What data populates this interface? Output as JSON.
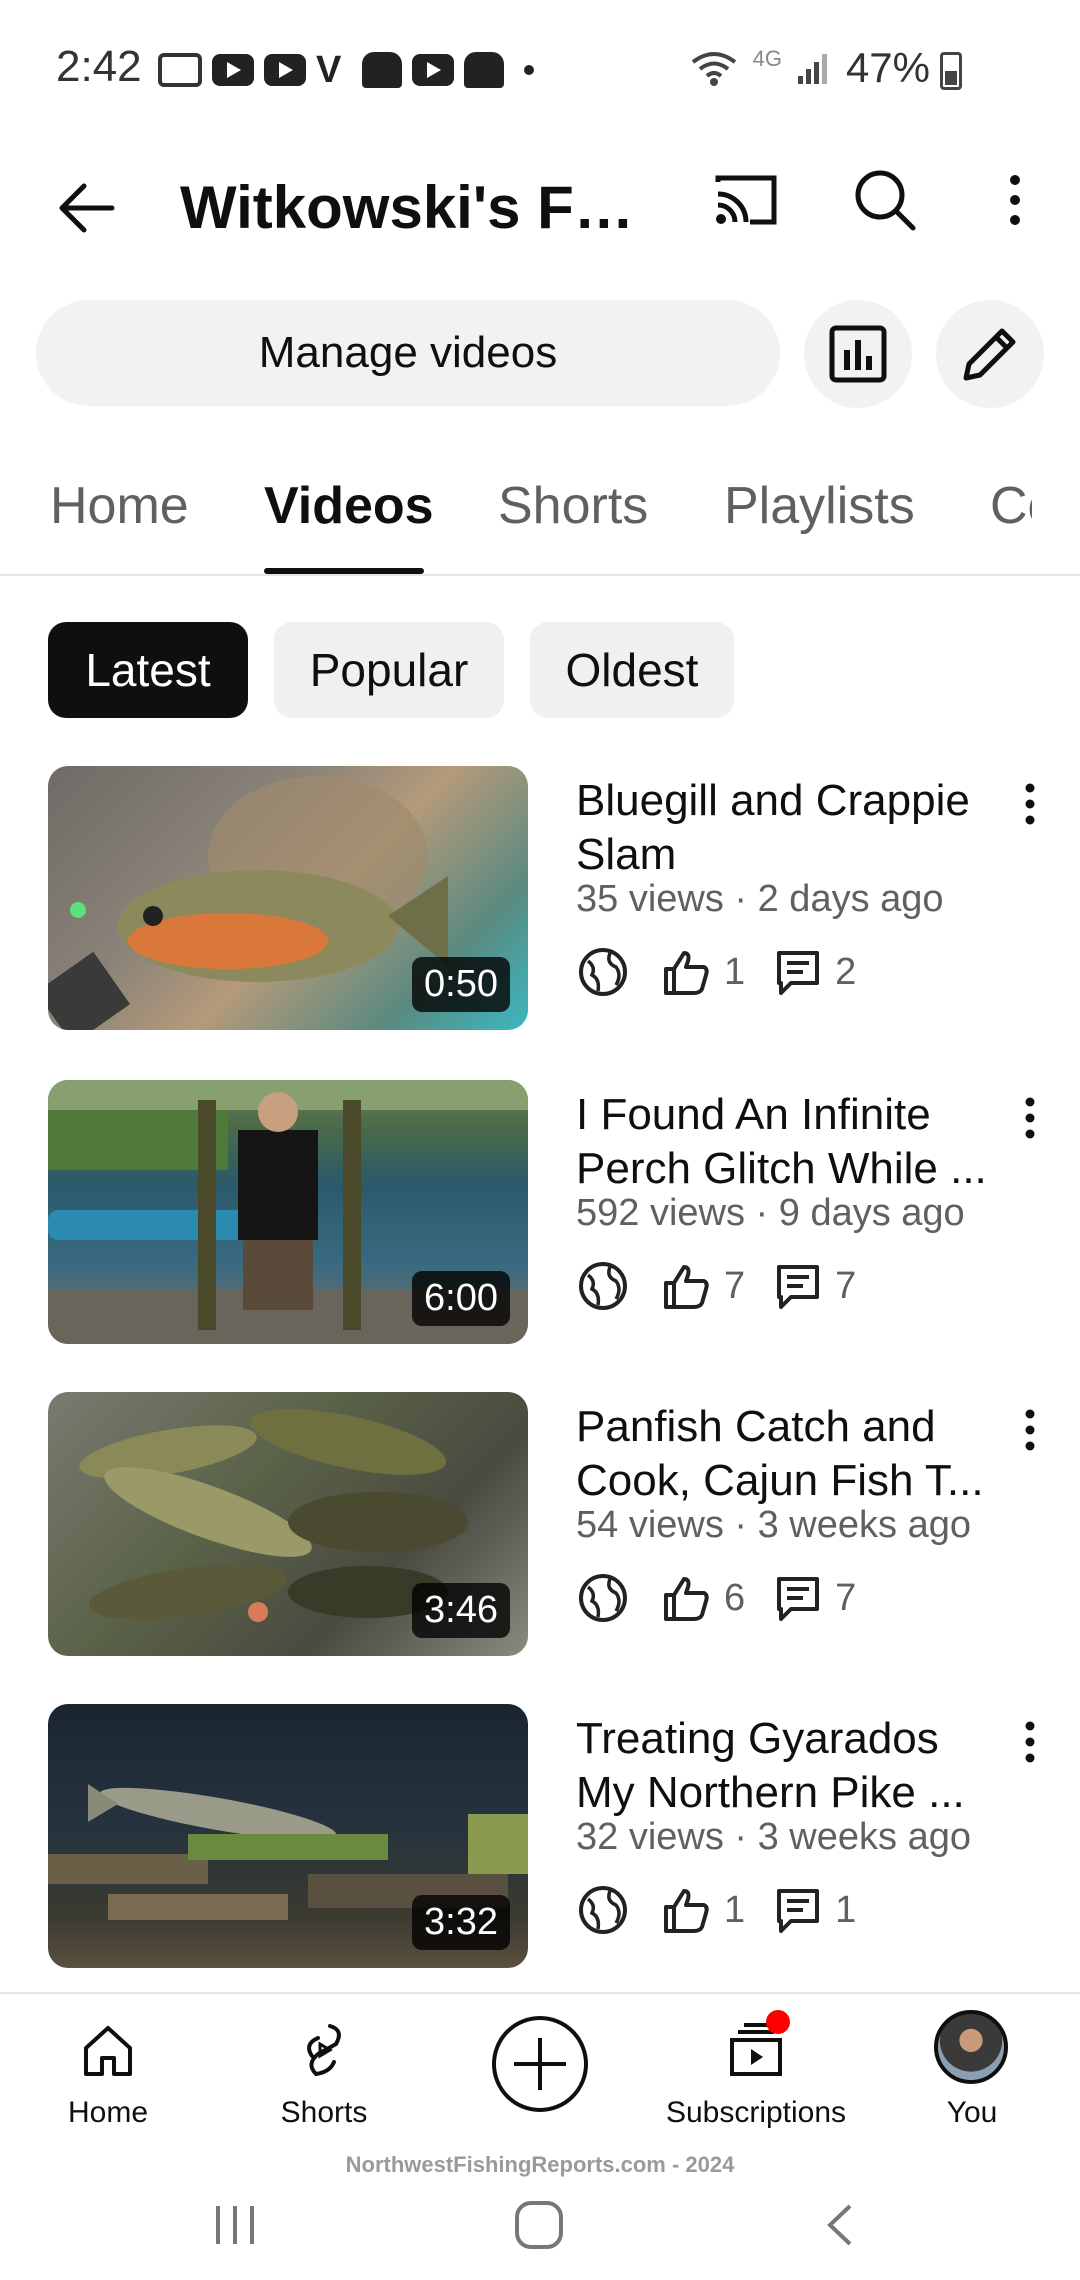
{
  "status_bar": {
    "time": "2:42",
    "network_label": "4G",
    "battery": "47%",
    "notification_icons": [
      "message-icon",
      "youtube-icon",
      "youtube-icon",
      "v-icon",
      "tooth-icon",
      "youtube-icon",
      "tooth-icon",
      "dot-icon"
    ]
  },
  "app_bar": {
    "title": "Witkowski's Fis..."
  },
  "actions": {
    "manage_videos": "Manage videos"
  },
  "tabs": [
    {
      "label": "Home"
    },
    {
      "label": "Videos",
      "active": true
    },
    {
      "label": "Shorts"
    },
    {
      "label": "Playlists"
    },
    {
      "label": "Co"
    }
  ],
  "chips": [
    {
      "label": "Latest",
      "active": true
    },
    {
      "label": "Popular"
    },
    {
      "label": "Oldest"
    }
  ],
  "videos": [
    {
      "title": "Bluegill and Crappie Slam",
      "meta": "35 views · 2 days ago",
      "duration": "0:50",
      "likes": "1",
      "comments": "2"
    },
    {
      "title": "I Found An Infinite Perch Glitch While ...",
      "meta": "592 views · 9 days ago",
      "duration": "6:00",
      "likes": "7",
      "comments": "7"
    },
    {
      "title": "Panfish Catch and Cook, Cajun Fish T...",
      "meta": "54 views · 3 weeks ago",
      "duration": "3:46",
      "likes": "6",
      "comments": "7"
    },
    {
      "title": "Treating Gyarados My Northern Pike ...",
      "meta": "32 views · 3 weeks ago",
      "duration": "3:32",
      "likes": "1",
      "comments": "1"
    }
  ],
  "bottom_nav": {
    "home": "Home",
    "shorts": "Shorts",
    "subscriptions": "Subscriptions",
    "you": "You"
  },
  "watermark": "NorthwestFishingReports.com - 2024",
  "colors": {
    "accent": "#0f0f0f",
    "chip_bg": "#f0f0f0",
    "muted_text": "#606060",
    "notification_dot": "#ff0000"
  }
}
